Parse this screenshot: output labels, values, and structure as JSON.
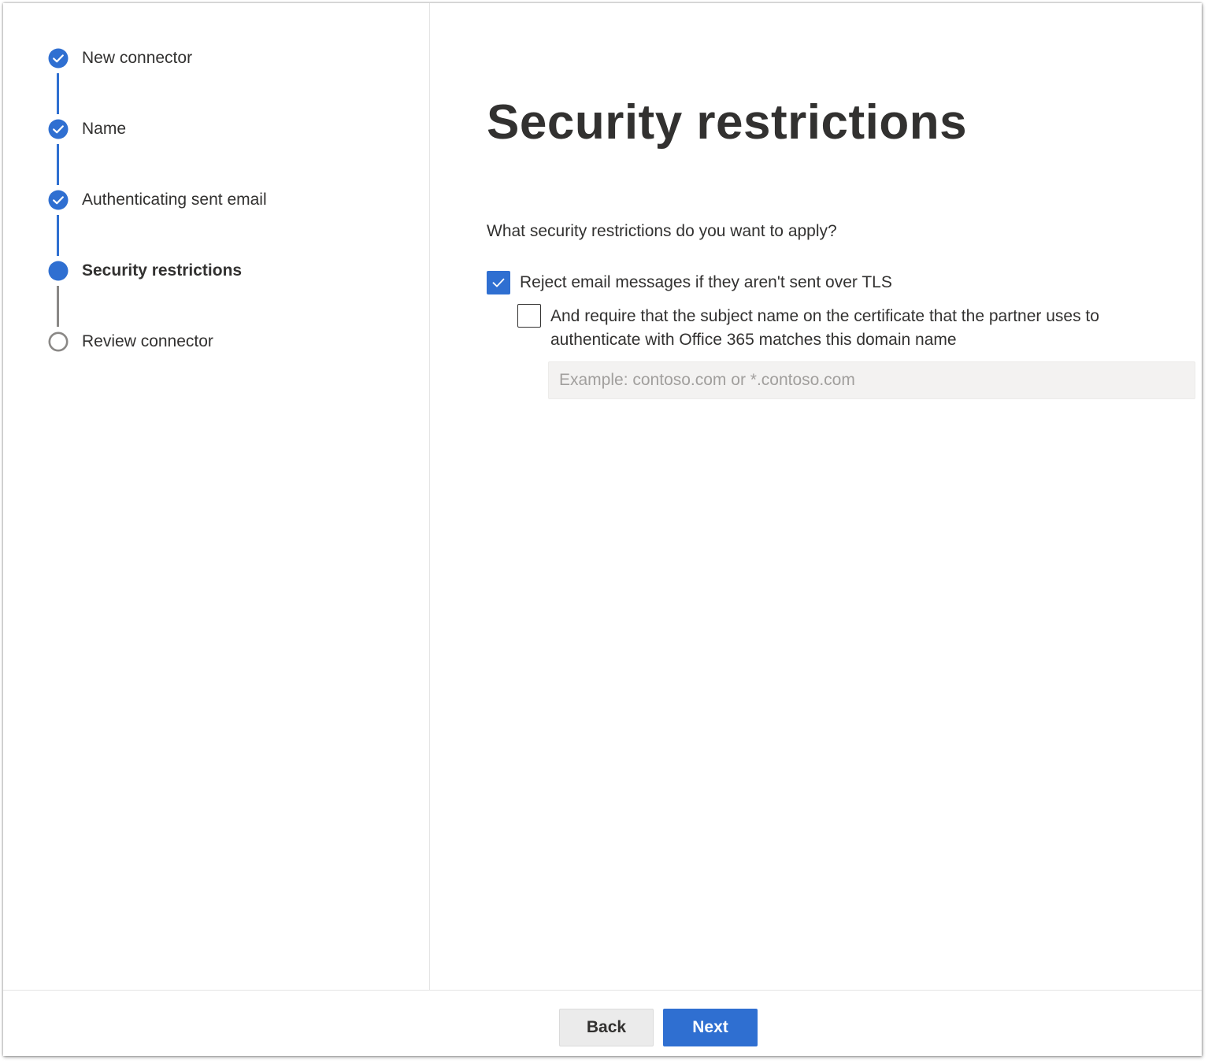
{
  "wizard": {
    "steps": [
      {
        "label": "New connector",
        "state": "completed"
      },
      {
        "label": "Name",
        "state": "completed"
      },
      {
        "label": "Authenticating sent email",
        "state": "completed"
      },
      {
        "label": "Security restrictions",
        "state": "current"
      },
      {
        "label": "Review connector",
        "state": "pending"
      }
    ]
  },
  "main": {
    "title": "Security restrictions",
    "question": "What security restrictions do you want to apply?",
    "options": [
      {
        "label": "Reject email messages if they aren't sent over TLS",
        "checked": true
      },
      {
        "label": "And require that the subject name on the certificate that the partner uses to authenticate with Office 365 matches this domain name",
        "checked": false
      }
    ],
    "domain_input": {
      "value": "",
      "placeholder": "Example: contoso.com or *.contoso.com"
    }
  },
  "footer": {
    "back_label": "Back",
    "next_label": "Next"
  },
  "colors": {
    "accent": "#2f6fd1",
    "pending": "#8a8886",
    "text": "#323130"
  },
  "icons": {
    "completed": "checkmark-circle-icon",
    "current": "filled-circle-icon",
    "pending": "empty-circle-icon",
    "checkbox_checked": "checkmark-icon"
  }
}
